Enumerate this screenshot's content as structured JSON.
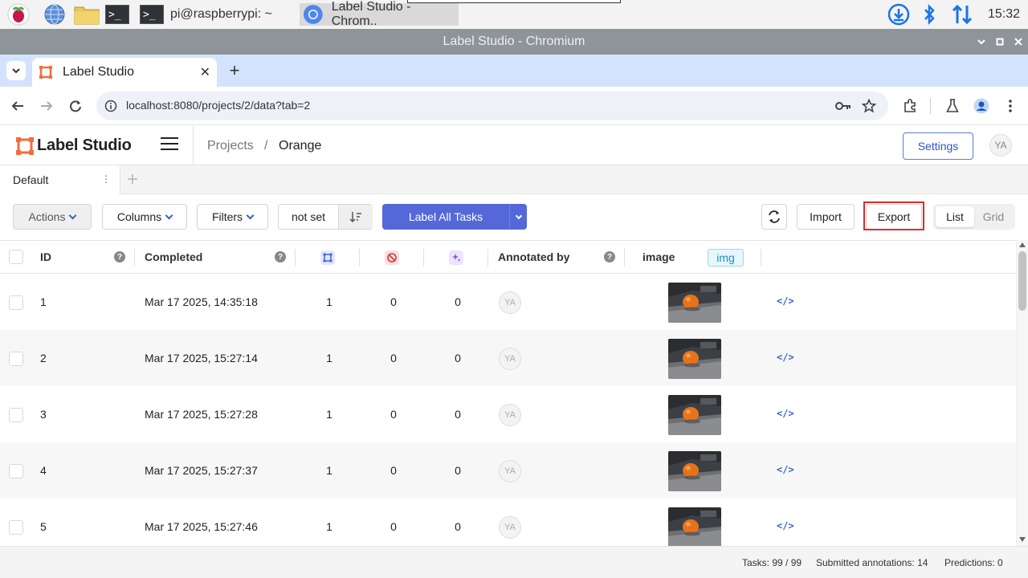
{
  "taskbar": {
    "tasks": [
      {
        "label": "pi@raspberrypi: ~"
      },
      {
        "label": "Label Studio - Chrom.."
      }
    ],
    "clock": "15:32"
  },
  "window": {
    "title": "Label Studio - Chromium"
  },
  "browser": {
    "tab_title": "Label Studio",
    "url": "localhost:8080/projects/2/data?tab=2"
  },
  "app": {
    "logo": "Label Studio",
    "breadcrumb": [
      "Projects",
      "/",
      "Orange"
    ],
    "settings_label": "Settings",
    "avatar": "YA"
  },
  "views": {
    "tabs": [
      {
        "label": "Default"
      }
    ],
    "add": "+"
  },
  "toolbar": {
    "actions": "Actions",
    "columns": "Columns",
    "filters": "Filters",
    "order": "not set",
    "label_all": "Label All Tasks",
    "import": "Import",
    "export": "Export",
    "list": "List",
    "grid": "Grid"
  },
  "table": {
    "headers": {
      "id": "ID",
      "completed": "Completed",
      "annotated_by": "Annotated by",
      "image": "image",
      "image_tag": "img"
    },
    "rows": [
      {
        "id": "1",
        "completed": "Mar 17 2025, 14:35:18",
        "annotations": "1",
        "cancelled": "0",
        "predictions": "0",
        "annotator": "YA"
      },
      {
        "id": "2",
        "completed": "Mar 17 2025, 15:27:14",
        "annotations": "1",
        "cancelled": "0",
        "predictions": "0",
        "annotator": "YA"
      },
      {
        "id": "3",
        "completed": "Mar 17 2025, 15:27:28",
        "annotations": "1",
        "cancelled": "0",
        "predictions": "0",
        "annotator": "YA"
      },
      {
        "id": "4",
        "completed": "Mar 17 2025, 15:27:37",
        "annotations": "1",
        "cancelled": "0",
        "predictions": "0",
        "annotator": "YA"
      },
      {
        "id": "5",
        "completed": "Mar 17 2025, 15:27:46",
        "annotations": "1",
        "cancelled": "0",
        "predictions": "0",
        "annotator": "YA"
      }
    ],
    "code_glyph": "</>"
  },
  "footer": {
    "tasks": "Tasks: 99 / 99",
    "submitted": "Submitted annotations: 14",
    "predictions": "Predictions: 0"
  }
}
